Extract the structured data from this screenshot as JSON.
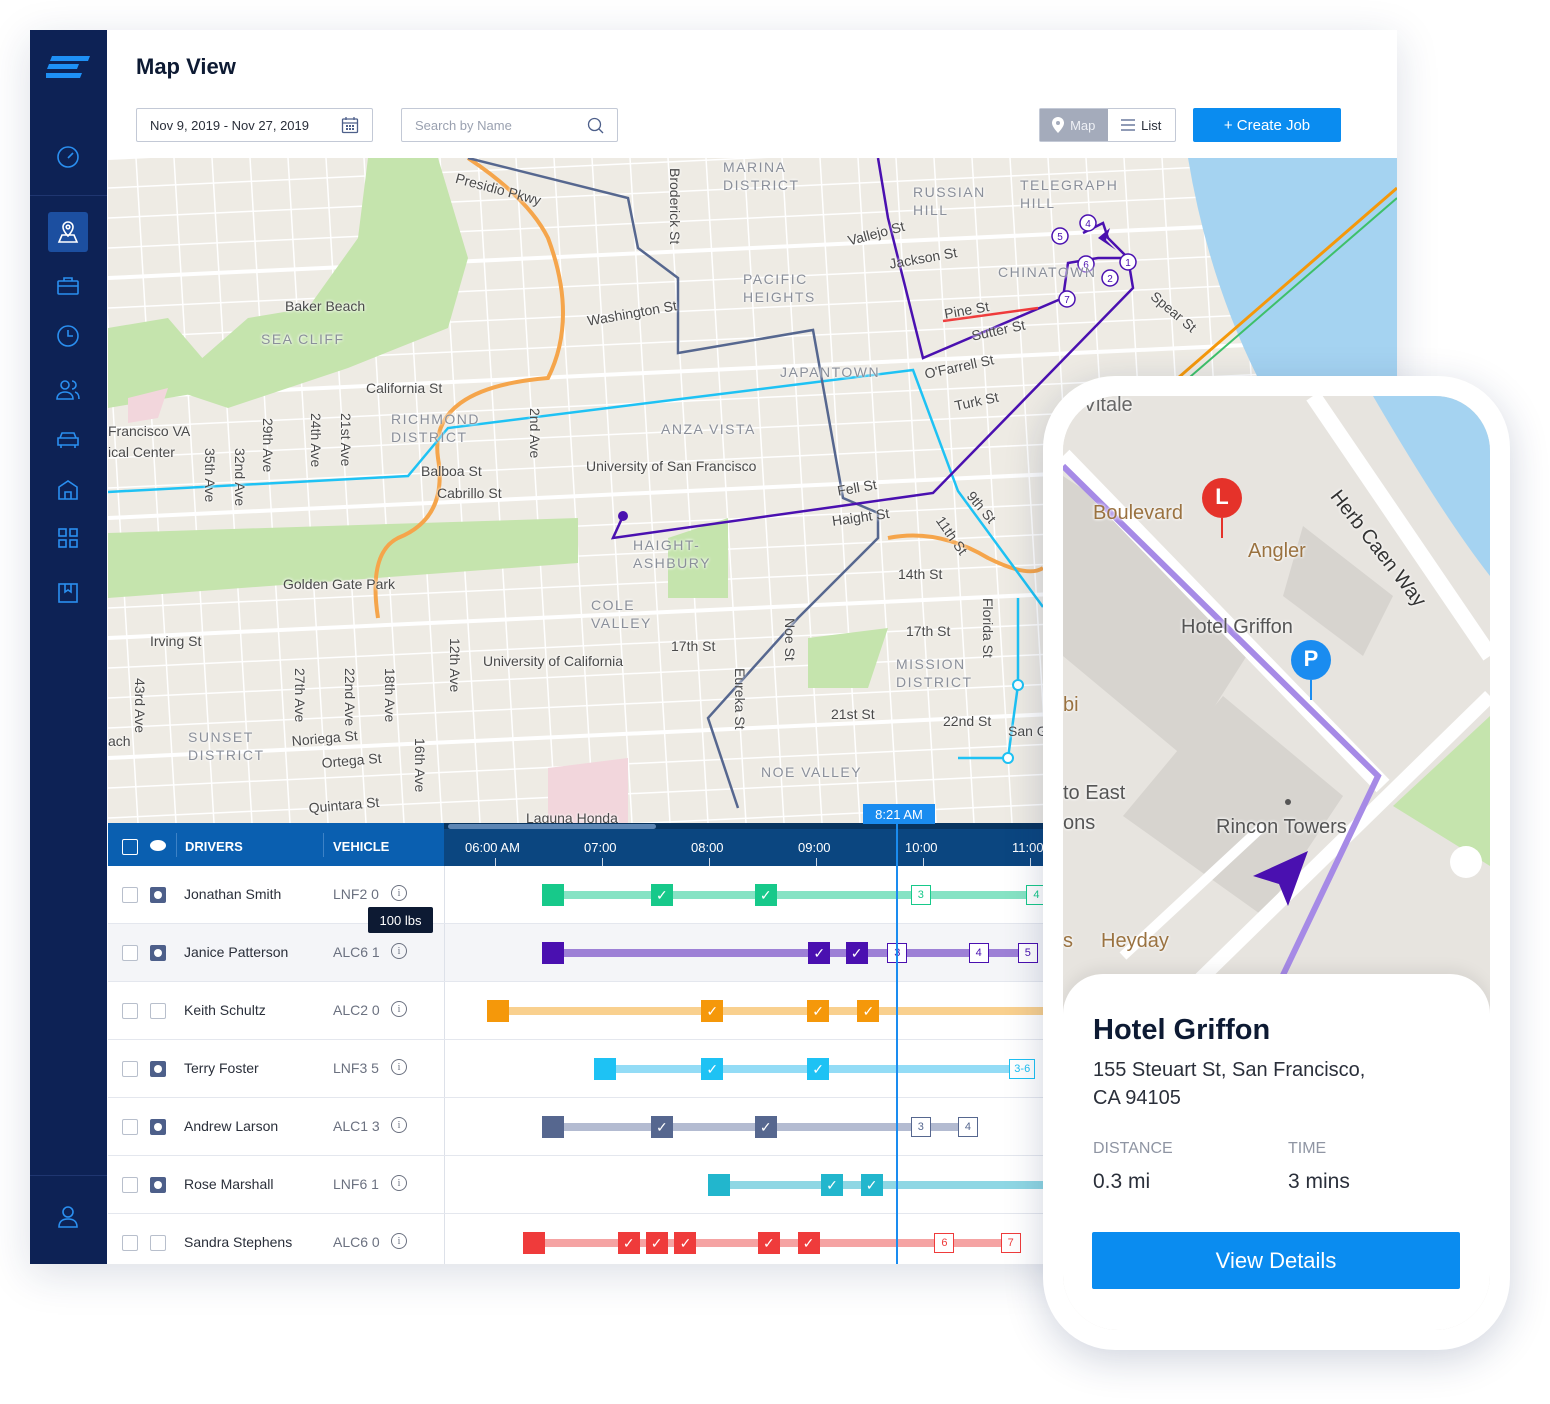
{
  "header": {
    "title": "Map View",
    "date_range": "Nov 9, 2019 - Nov 27, 2019",
    "search_placeholder": "Search by Name",
    "view_map": "Map",
    "view_list": "List",
    "create_job": "+ Create Job"
  },
  "sidebar": {
    "items": [
      "dashboard",
      "map",
      "jobs",
      "history",
      "team",
      "vehicles",
      "warehouses",
      "apps",
      "book",
      "profile"
    ],
    "active": "map"
  },
  "map": {
    "labels": [
      {
        "t": "MARINA DISTRICT",
        "d": true
      },
      {
        "t": "RUSSIAN HILL",
        "d": true
      },
      {
        "t": "TELEGRAPH HILL",
        "d": true
      },
      {
        "t": "CHINATOWN",
        "d": true
      },
      {
        "t": "PACIFIC HEIGHTS",
        "d": true
      },
      {
        "t": "JAPANTOWN",
        "d": true
      },
      {
        "t": "RICHMOND DISTRICT",
        "d": true
      },
      {
        "t": "ANZA VISTA",
        "d": true
      },
      {
        "t": "HAIGHT-ASHBURY",
        "d": true
      },
      {
        "t": "COLE VALLEY",
        "d": true
      },
      {
        "t": "SUNSET DISTRICT",
        "d": true
      },
      {
        "t": "MISSION DISTRICT",
        "d": true
      },
      {
        "t": "NOE VALLEY",
        "d": true
      },
      {
        "t": "SEA CLIFF",
        "d": true
      },
      {
        "t": "Presidio Pkwy"
      },
      {
        "t": "Broderick St"
      },
      {
        "t": "Vallejo St"
      },
      {
        "t": "Jackson St"
      },
      {
        "t": "Washington St"
      },
      {
        "t": "Baker Beach"
      },
      {
        "t": "California St"
      },
      {
        "t": "Pine St"
      },
      {
        "t": "Sutter St"
      },
      {
        "t": "O'Farrell St"
      },
      {
        "t": "Turk St"
      },
      {
        "t": "Spear St"
      },
      {
        "t": "Francisco VA"
      },
      {
        "t": "ical Center"
      },
      {
        "t": "Balboa St"
      },
      {
        "t": "Cabrillo St"
      },
      {
        "t": "University of San Francisco"
      },
      {
        "t": "Fell St"
      },
      {
        "t": "Haight St"
      },
      {
        "t": "9th St"
      },
      {
        "t": "11th St"
      },
      {
        "t": "14th St"
      },
      {
        "t": "Golden Gate Park"
      },
      {
        "t": "Irving St"
      },
      {
        "t": "17th St"
      },
      {
        "t": "17th St"
      },
      {
        "t": "University of California"
      },
      {
        "t": "Noriega St"
      },
      {
        "t": "Ortega St"
      },
      {
        "t": "Quintara St"
      },
      {
        "t": "21st St"
      },
      {
        "t": "22nd St"
      },
      {
        "t": "Laguna Honda"
      },
      {
        "t": "Florida St"
      },
      {
        "t": "San Gener"
      },
      {
        "t": "ach"
      },
      {
        "t": "35th Ave"
      },
      {
        "t": "32nd Ave"
      },
      {
        "t": "29th Ave"
      },
      {
        "t": "24th Ave"
      },
      {
        "t": "21st Ave"
      },
      {
        "t": "2nd Ave"
      },
      {
        "t": "43rd Ave"
      },
      {
        "t": "27th Ave"
      },
      {
        "t": "22nd Ave"
      },
      {
        "t": "18th Ave"
      },
      {
        "t": "16th Ave"
      },
      {
        "t": "12th Ave"
      },
      {
        "t": "Eureka St"
      },
      {
        "t": "Noe St"
      }
    ],
    "stop_numbers": [
      "1",
      "2",
      "4",
      "5",
      "6",
      "7"
    ]
  },
  "timeline": {
    "headers": {
      "drivers": "DRIVERS",
      "vehicle": "VEHICLE"
    },
    "ticks": [
      "06:00 AM",
      "07:00",
      "08:00",
      "09:00",
      "10:00",
      "11:00"
    ],
    "current_time": "8:21 AM",
    "tooltip": "100 lbs",
    "drivers": [
      {
        "name": "Jonathan Smith",
        "vehicle": "LNF2 0",
        "visible": true,
        "color": "#17c98a",
        "line": "#86e3c4",
        "start": 6.54,
        "done": [
          7.56,
          8.53
        ],
        "pending": [
          {
            "t": 9.98,
            "n": "3"
          },
          {
            "t": 11.06,
            "n": "4"
          }
        ]
      },
      {
        "name": "Janice Patterson",
        "vehicle": "ALC6 1",
        "visible": true,
        "color": "#4a10b0",
        "line": "#9d80d6",
        "start": 6.54,
        "done": [
          9.03,
          9.38
        ],
        "pending": [
          {
            "t": 9.76,
            "n": "3"
          },
          {
            "t": 10.52,
            "n": "4"
          },
          {
            "t": 10.98,
            "n": "5"
          }
        ]
      },
      {
        "name": "Keith Schultz",
        "vehicle": "ALC2 0",
        "visible": false,
        "color": "#f5980a",
        "line": "#f9d08e",
        "start": 6.03,
        "done": [
          8.03,
          9.02,
          9.49
        ],
        "pending": []
      },
      {
        "name": "Terry Foster",
        "vehicle": "LNF3 5",
        "visible": true,
        "color": "#1ec2f4",
        "line": "#93dcf6",
        "start": 7.03,
        "done": [
          8.03,
          9.02
        ],
        "pending": [
          {
            "t": 10.9,
            "n": "3-6"
          }
        ]
      },
      {
        "name": "Andrew Larson",
        "vehicle": "ALC1 3",
        "visible": true,
        "color": "#56678f",
        "line": "#b3bbd1",
        "start": 6.54,
        "done": [
          7.56,
          8.53
        ],
        "pending": [
          {
            "t": 9.98,
            "n": "3"
          },
          {
            "t": 10.42,
            "n": "4"
          }
        ]
      },
      {
        "name": "Rose Marshall",
        "vehicle": "LNF6 1",
        "visible": true,
        "color": "#22b6cd",
        "line": "#8fd7e4",
        "start": 8.09,
        "done": [
          9.15,
          9.52
        ],
        "pending": []
      },
      {
        "name": "Sandra Stephens",
        "vehicle": "ALC6 0",
        "visible": false,
        "color": "#ef3b3b",
        "line": "#f5a3a3",
        "start": 6.36,
        "done": [
          7.25,
          7.51,
          7.78,
          8.56,
          8.93
        ],
        "pending": [
          {
            "t": 10.2,
            "n": "6"
          },
          {
            "t": 10.82,
            "n": "7"
          }
        ]
      }
    ]
  },
  "phone": {
    "map_labels": [
      "Vitale",
      "Boulevard",
      "Angler",
      "Hotel Griffon",
      "Herb Caen Way",
      "bi",
      "to East",
      "ons",
      "Rincon Towers",
      "s",
      "Heyday"
    ],
    "pins": {
      "start": "L",
      "parking": "P"
    },
    "place": {
      "name": "Hotel Griffon",
      "address_line1": "155 Steuart St, San Francisco,",
      "address_line2": "CA 94105"
    },
    "distance_label": "DISTANCE",
    "distance": "0.3 mi",
    "time_label": "TIME",
    "time": "3 mins",
    "button": "View Details"
  },
  "colors": {
    "primary": "#0a8cf0",
    "sidebar": "#0d2255",
    "timeline_header": "#0b4680"
  }
}
